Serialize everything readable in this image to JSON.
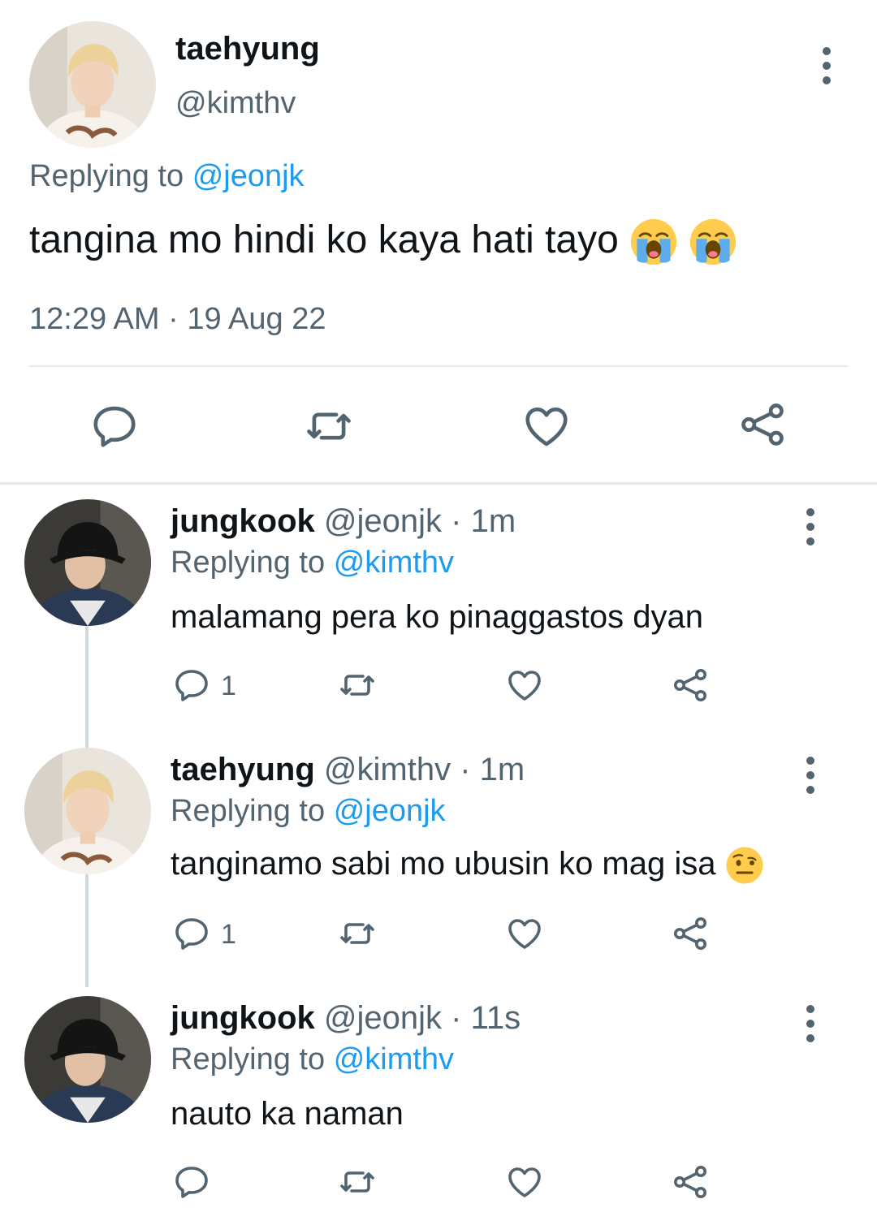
{
  "main_tweet": {
    "name": "taehyung",
    "handle": "@kimthv",
    "replying_prefix": "Replying to",
    "replying_to": "@jeonjk",
    "text": "tangina mo hindi ko kaya hati tayo",
    "emoji": "crying-face",
    "timestamp": "12:29 AM · 19 Aug 22"
  },
  "replies": [
    {
      "name": "jungkook",
      "meta": "@jeonjk · 1m",
      "replying_prefix": "Replying to",
      "replying_to": "@kimthv",
      "text": "malamang pera ko pinaggastos dyan",
      "reply_count": "1"
    },
    {
      "name": "taehyung",
      "meta": "@kimthv · 1m",
      "replying_prefix": "Replying to",
      "replying_to": "@jeonjk",
      "text": "tanginamo sabi mo ubusin ko mag isa",
      "emoji": "face-with-raised-eyebrow",
      "reply_count": "1"
    },
    {
      "name": "jungkook",
      "meta": "@jeonjk · 11s",
      "replying_prefix": "Replying to",
      "replying_to": "@kimthv",
      "text": "nauto ka naman",
      "reply_count": ""
    }
  ],
  "colors": {
    "accent": "#1d9bf0",
    "secondary_text": "#536471",
    "divider": "#e6e9eb",
    "thread_line": "#cfd9de"
  }
}
